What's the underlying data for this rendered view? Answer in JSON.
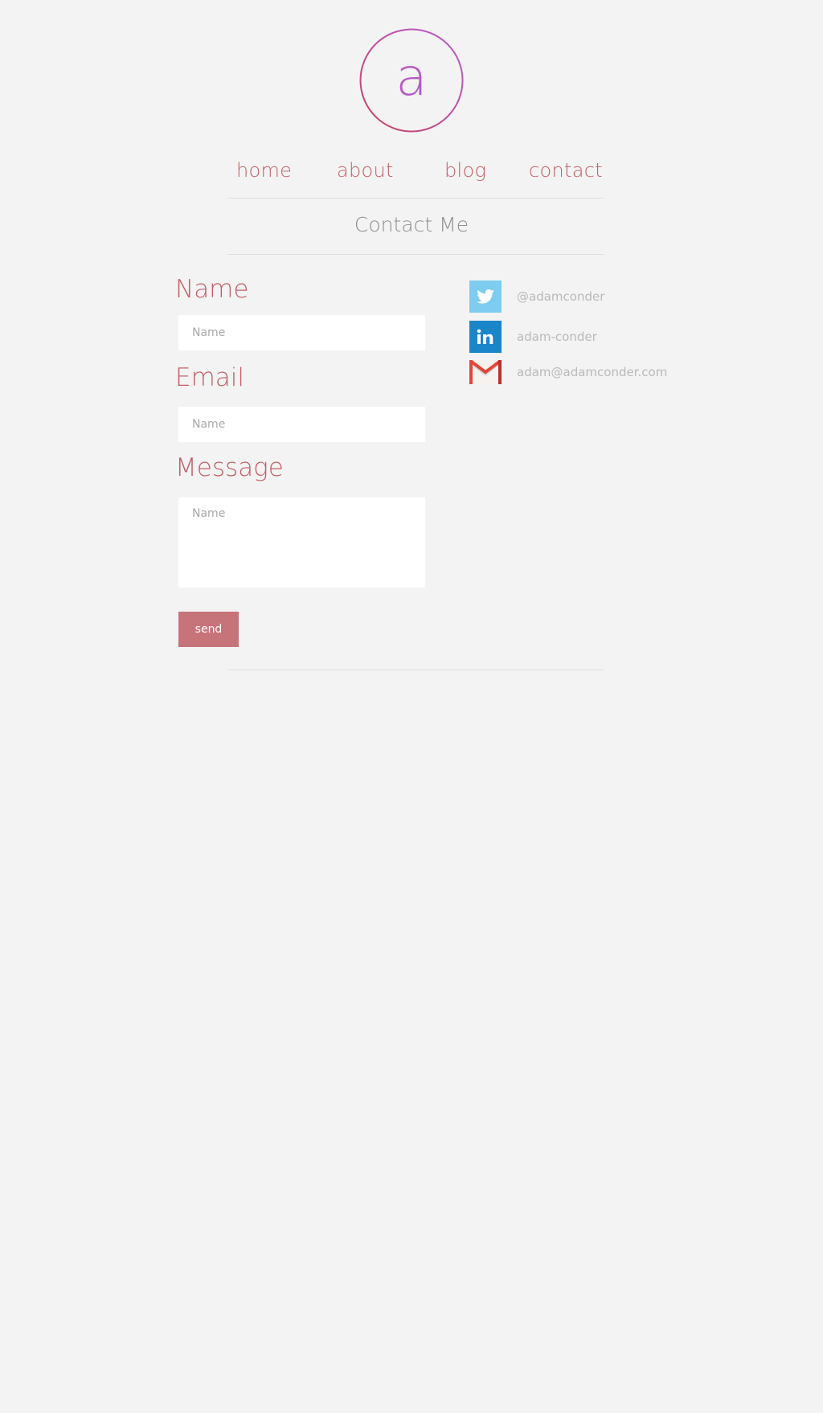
{
  "logo": {
    "letter": "a"
  },
  "nav": {
    "items": [
      {
        "label": "home"
      },
      {
        "label": "about"
      },
      {
        "label": "blog"
      },
      {
        "label": "contact"
      }
    ]
  },
  "page": {
    "title": "Contact Me"
  },
  "form": {
    "name_label": "Name",
    "name_placeholder": "Name",
    "email_label": "Email",
    "email_placeholder": "Name",
    "message_label": "Message",
    "message_placeholder": "Name",
    "send_label": "send"
  },
  "social": [
    {
      "icon": "twitter-icon",
      "text": "@adamconder",
      "color": "#7ecdf0"
    },
    {
      "icon": "linkedin-icon",
      "text": "adam-conder",
      "color": "#1b85c9"
    },
    {
      "icon": "gmail-icon",
      "text": "adam@adamconder.com",
      "color": "#d44638"
    }
  ],
  "colors": {
    "accent": "#c35f68",
    "button": "#c6737a",
    "background": "#f3f3f3",
    "logo_gradient_start": "#b65bd4",
    "logo_gradient_end": "#c8405f"
  }
}
